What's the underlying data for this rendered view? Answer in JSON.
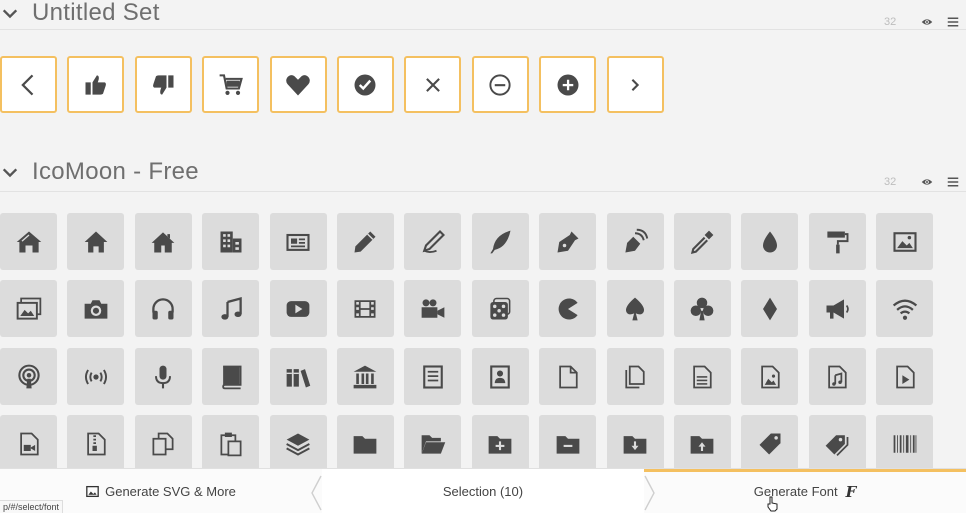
{
  "sets": [
    {
      "title": "Untitled Set",
      "count": "32",
      "icons": [
        "arrow-left-icon",
        "thumbs-up-icon",
        "thumbs-down-icon",
        "cart-icon",
        "heart-icon",
        "checkmark-circle-icon",
        "cross-icon",
        "minus-circle-icon",
        "plus-circle-icon",
        "chevron-right-icon"
      ]
    },
    {
      "title": "IcoMoon - Free",
      "count": "32"
    }
  ],
  "icon_rows": [
    [
      "home-icon",
      "home2-icon",
      "home3-icon",
      "office-icon",
      "newspaper-icon",
      "pencil-icon",
      "pencil2-icon",
      "quill-icon",
      "pen-icon",
      "blog-icon",
      "eyedropper-icon",
      "droplet-icon",
      "paint-format-icon",
      "image-icon"
    ],
    [
      "images-icon",
      "camera-icon",
      "headphones-icon",
      "music-icon",
      "play-icon",
      "film-icon",
      "video-camera-icon",
      "dice-icon",
      "pacman-icon",
      "spades-icon",
      "clubs-icon",
      "diamonds-icon",
      "bullhorn-icon",
      "connection-icon"
    ],
    [
      "podcast-icon",
      "feed-icon",
      "mic-icon",
      "book-icon",
      "books-icon",
      "library-icon",
      "file-text-icon",
      "profile-icon",
      "file-empty-icon",
      "files-empty-icon",
      "file-text2-icon",
      "file-picture-icon",
      "file-music-icon",
      "file-play-icon"
    ],
    [
      "file-video-icon",
      "file-zip-icon",
      "copy-icon",
      "paste-icon",
      "stack-icon",
      "folder-icon",
      "folder-open-icon",
      "folder-plus-icon",
      "folder-minus-icon",
      "folder-download-icon",
      "folder-upload-icon",
      "price-tag-icon",
      "price-tags-icon",
      "barcode-icon"
    ]
  ],
  "bottom_bar": {
    "generate_svg": "Generate SVG & More",
    "selection": "Selection (10)",
    "generate_font": "Generate Font"
  },
  "status_url": "p/#/select/font",
  "colors": {
    "accent": "#f4c060",
    "icon": "#4a4a4a",
    "tile": "#dcdcdc",
    "background": "#f3f3f3"
  }
}
